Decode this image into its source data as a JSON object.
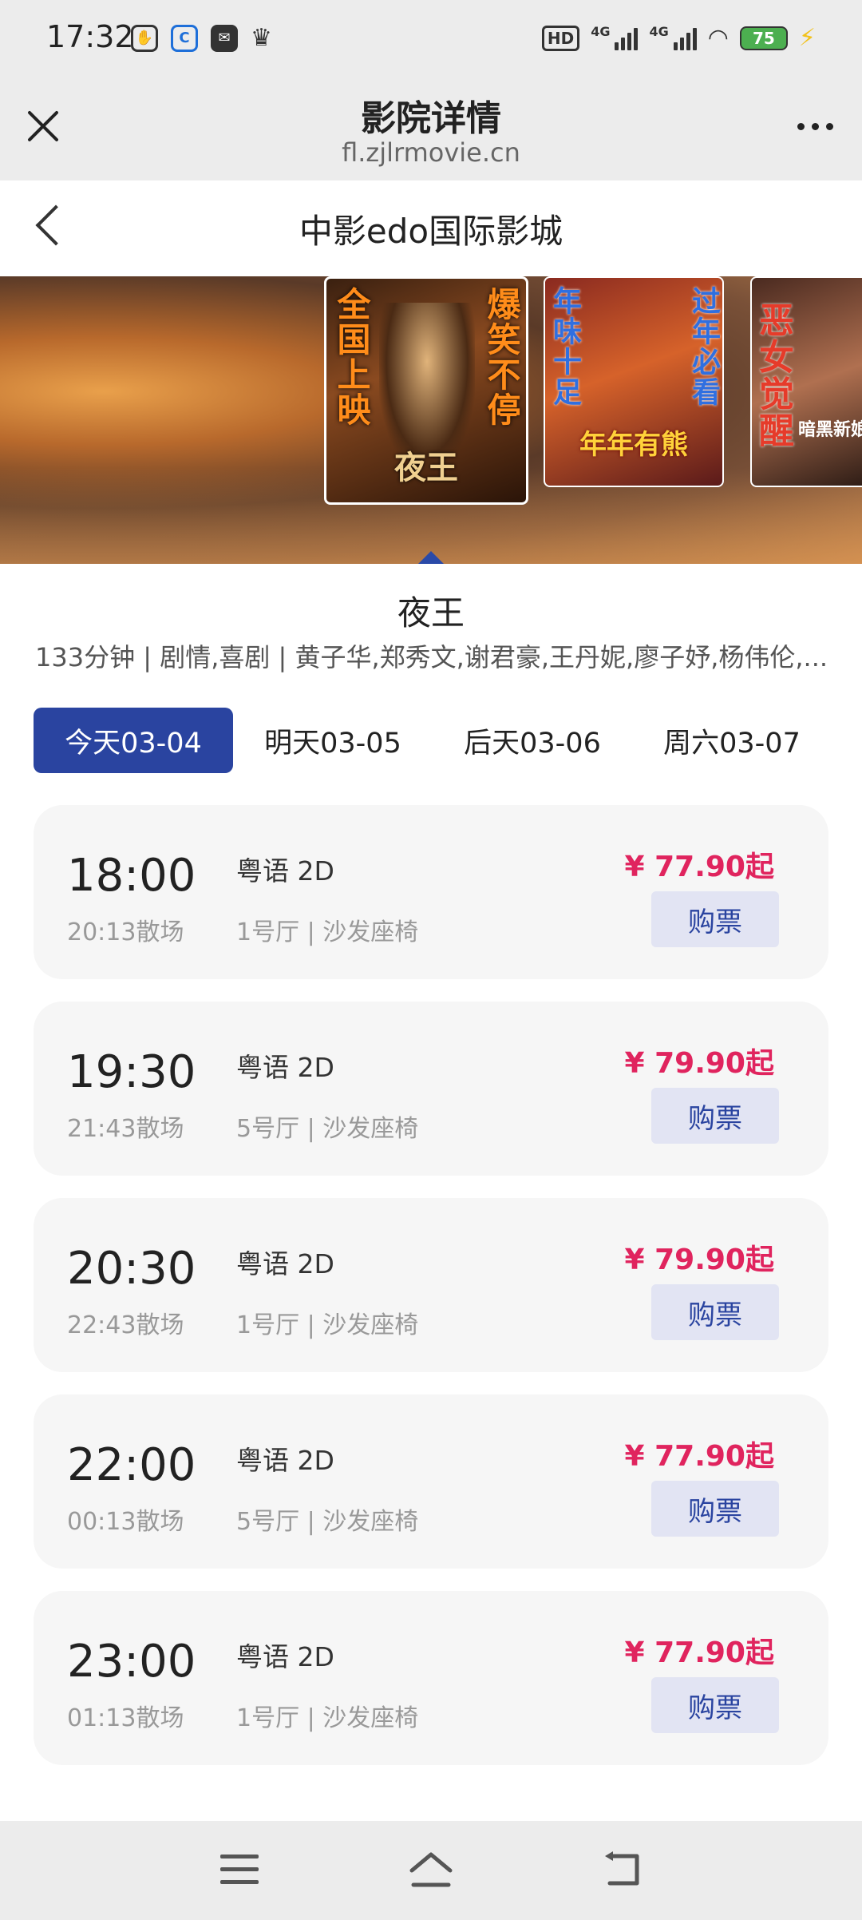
{
  "status_bar": {
    "time": "17:32",
    "left_icons": [
      "hand-icon",
      "browser-c-icon",
      "mail-icon",
      "crown-icon"
    ],
    "hd_label": "HD",
    "network_1": "4G",
    "network_2": "4G",
    "battery": "75"
  },
  "browser": {
    "title": "影院详情",
    "url": "fl.zjlrmovie.cn"
  },
  "page": {
    "title": "中影edo国际影城"
  },
  "posters": [
    {
      "left_text": "全国上映",
      "right_text": "爆笑不停",
      "bottom_text": "夜王"
    },
    {
      "left_text": "年味十足",
      "right_text": "过年必看",
      "bottom_text": "年年有熊"
    },
    {
      "left_text": "恶女觉醒",
      "bottom_text": "暗黑新娘"
    }
  ],
  "movie": {
    "name": "夜王",
    "meta": "133分钟 | 剧情,喜剧 | 黄子华,郑秀文,谢君豪,王丹妮,廖子妤,杨伟伦,..."
  },
  "date_tabs": [
    {
      "label": "今天03-04",
      "active": true
    },
    {
      "label": "明天03-05"
    },
    {
      "label": "后天03-06"
    },
    {
      "label": "周六03-07"
    }
  ],
  "sessions": [
    {
      "start": "18:00",
      "end": "20:13散场",
      "lang": "粤语 2D",
      "hall": "1号厅 | 沙发座椅",
      "price": "¥ 77.90起",
      "buy": "购票"
    },
    {
      "start": "19:30",
      "end": "21:43散场",
      "lang": "粤语 2D",
      "hall": "5号厅 | 沙发座椅",
      "price": "¥ 79.90起",
      "buy": "购票"
    },
    {
      "start": "20:30",
      "end": "22:43散场",
      "lang": "粤语 2D",
      "hall": "1号厅 | 沙发座椅",
      "price": "¥ 79.90起",
      "buy": "购票"
    },
    {
      "start": "22:00",
      "end": "00:13散场",
      "lang": "粤语 2D",
      "hall": "5号厅 | 沙发座椅",
      "price": "¥ 77.90起",
      "buy": "购票"
    },
    {
      "start": "23:00",
      "end": "01:13散场",
      "lang": "粤语 2D",
      "hall": "1号厅 | 沙发座椅",
      "price": "¥ 77.90起",
      "buy": "购票"
    }
  ],
  "nav": {
    "icons": [
      "menu-icon",
      "home-icon",
      "back-icon"
    ]
  },
  "colors": {
    "accent": "#2a44a0",
    "price": "#e0245e",
    "card_bg": "#f6f6f6",
    "buy_bg": "#e2e4f3"
  }
}
